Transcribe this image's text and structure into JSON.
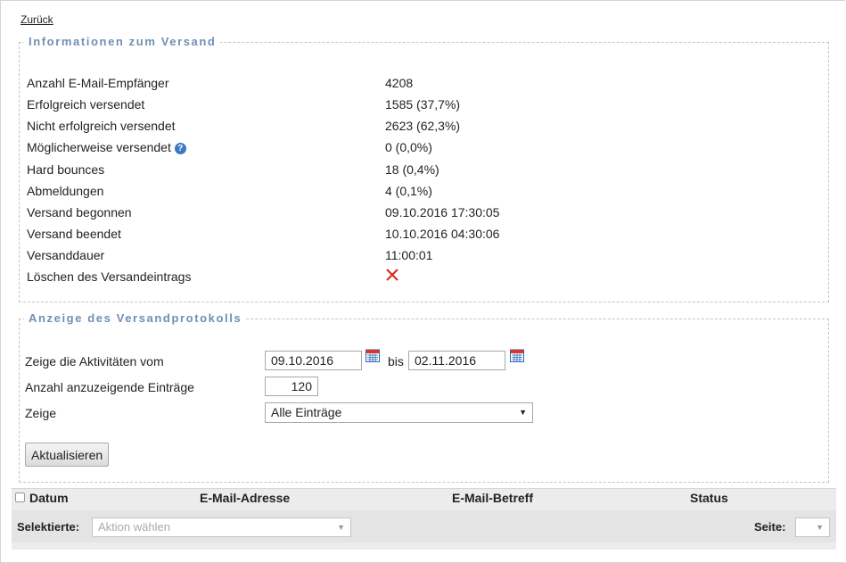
{
  "nav": {
    "back_label": "Zurück"
  },
  "info": {
    "legend": "Informationen zum Versand",
    "rows": [
      {
        "label": "Anzahl E-Mail-Empfänger",
        "value": "4208"
      },
      {
        "label": "Erfolgreich versendet",
        "value": "1585 (37,7%)"
      },
      {
        "label": "Nicht erfolgreich versendet",
        "value": "2623 (62,3%)"
      },
      {
        "label": "Möglicherweise versendet",
        "value": "0 (0,0%)",
        "help_icon": "help-icon"
      },
      {
        "label": "Hard bounces",
        "value": "18 (0,4%)"
      },
      {
        "label": "Abmeldungen",
        "value": "4 (0,1%)"
      },
      {
        "label": "Versand begonnen",
        "value": "09.10.2016 17:30:05"
      },
      {
        "label": "Versand beendet",
        "value": "10.10.2016 04:30:06"
      },
      {
        "label": "Versanddauer",
        "value": "11:00:01"
      },
      {
        "label": "Löschen des Versandeintrags",
        "icon": "delete-x-icon"
      }
    ]
  },
  "protocol": {
    "legend": "Anzeige des Versandprotokolls",
    "from_label": "Zeige die Aktivitäten vom",
    "from_value": "09.10.2016",
    "bis_label": "bis",
    "to_value": "02.11.2016",
    "count_label": "Anzahl anzuzeigende Einträge",
    "count_value": "120",
    "show_label": "Zeige",
    "show_selected": "Alle Einträge",
    "refresh_button": "Aktualisieren",
    "calendar_icon": "calendar-icon",
    "calendar_color": "#d0392b"
  },
  "table": {
    "columns": [
      "Datum",
      "E-Mail-Adresse",
      "E-Mail-Betreff",
      "Status"
    ],
    "selected_label": "Selektierte:",
    "action_placeholder": "Aktion wählen",
    "page_label": "Seite:"
  },
  "colors": {
    "legend": "#6f8fb3",
    "help_icon": "#3d78c4",
    "delete_icon": "#d9261c"
  }
}
